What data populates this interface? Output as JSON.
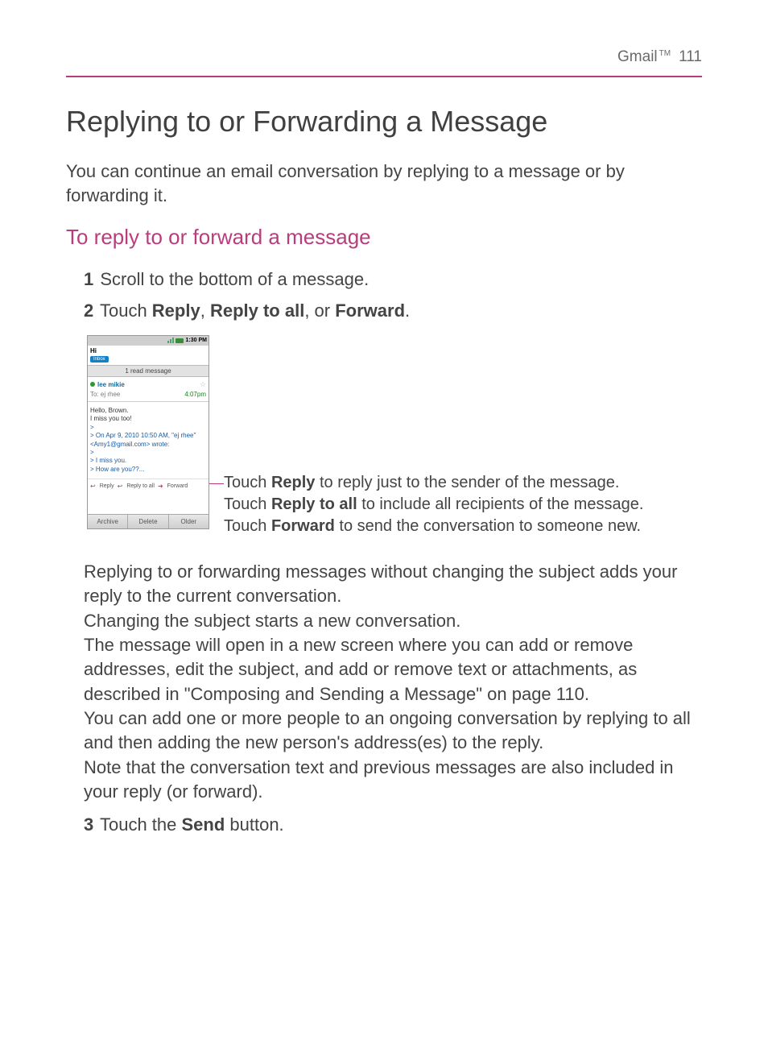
{
  "header": {
    "section": "Gmail",
    "tm": "TM",
    "page_number": "111"
  },
  "title": "Replying to or Forwarding a Message",
  "intro": "You can continue an email conversation by replying to a message or by forwarding it.",
  "subhead": "To reply to or forward a message",
  "steps": {
    "s1": {
      "num": "1",
      "text": "Scroll to the bottom of a message."
    },
    "s2": {
      "num": "2",
      "pre": "Touch ",
      "opt1": "Reply",
      "sep1": ", ",
      "opt2": "Reply to all",
      "sep2": ", or ",
      "opt3": "Forward",
      "post": "."
    },
    "s3": {
      "num": "3",
      "pre": "Touch the ",
      "b": "Send",
      "post": " button."
    }
  },
  "screenshot": {
    "status_time": "1:30 PM",
    "subject": "Hi",
    "inbox_label": "Inbox",
    "read_bar": "1 read message",
    "sender": "lee mikie",
    "to_label": "To: ej rhee",
    "msg_time": "4:07pm",
    "body_line1": "Hello, Brown.",
    "body_line2": "I miss you too!",
    "quote_gt": ">",
    "quote_line1": "> On Apr 9, 2010 10:50 AM, \"ej rhee\"",
    "quote_line2": "<Amy1@gmail.com> wrote:",
    "quote_line3": "> I miss you.",
    "quote_line4": "> How are you??...",
    "reply": "Reply",
    "reply_all": "Reply to all",
    "forward": "Forward",
    "btn_archive": "Archive",
    "btn_delete": "Delete",
    "btn_older": "Older"
  },
  "callout": {
    "l1_pre": "Touch ",
    "l1_b": "Reply",
    "l1_post": " to reply just to the sender of the message.",
    "l2_pre": "Touch ",
    "l2_b": "Reply to all",
    "l2_post": " to include all recipients of the message.",
    "l3_pre": "Touch ",
    "l3_b": "Forward",
    "l3_post": " to send the conversation to someone new."
  },
  "body_paras": {
    "p1": "Replying to or forwarding messages without changing the subject adds your reply to the current conversation.",
    "p2": "Changing the subject starts a new conversation.",
    "p3": "The message will open in a new screen where you can add or remove addresses, edit the subject, and add or remove text or attachments, as described in \"Composing and Sending a Message\" on page 110.",
    "p4": "You can add one or more people to an ongoing conversation by replying to all and then adding the new person's address(es) to the reply.",
    "p5": "Note that the conversation text and previous messages are also included in your reply (or forward)."
  }
}
